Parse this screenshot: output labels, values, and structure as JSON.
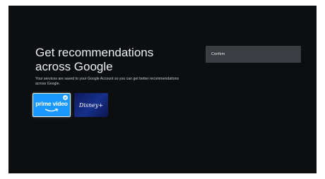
{
  "screen": {
    "title": "Get recommendations across Google",
    "subtitle": "Your services are saved to your Google Account so you can get better recommendations across Google."
  },
  "apps": [
    {
      "name": "prime video",
      "selected": true,
      "color": "#1a98ff",
      "icon": "prime-video-logo"
    },
    {
      "name": "Disney+",
      "selected": false,
      "color": "#14287a",
      "icon": "disney-plus-logo"
    }
  ],
  "actions": {
    "confirm_label": "Confirm"
  },
  "colors": {
    "background": "#0d0e10",
    "button": "#3a3d41",
    "accent": "#1a98ff"
  }
}
